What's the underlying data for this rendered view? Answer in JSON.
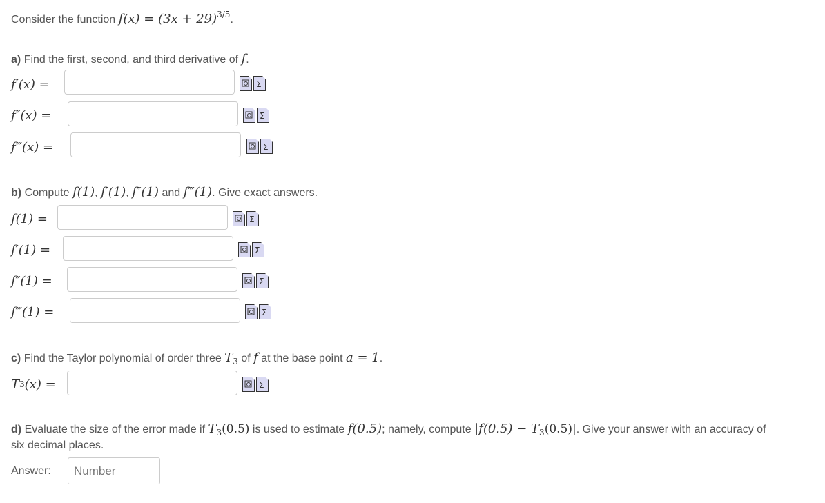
{
  "intro": {
    "prefix": "Consider the function",
    "func": "f(x) = (3x + 29)",
    "exponent": "3/5",
    "suffix": "."
  },
  "part_a": {
    "tag": "a)",
    "text": "Find the first, second, and third derivative of",
    "var": "f",
    "end": ".",
    "rows": [
      {
        "label": "f′(x) ="
      },
      {
        "label": "f″(x) ="
      },
      {
        "label": "f‴(x) ="
      }
    ]
  },
  "part_b": {
    "tag": "b)",
    "text_start": "Compute",
    "items": [
      "f(1)",
      "f′(1)",
      "f″(1)"
    ],
    "and_word": "and",
    "last": "f‴(1)",
    "text_end": ". Give exact answers.",
    "rows": [
      {
        "label": "f(1) ="
      },
      {
        "label": "f′(1) ="
      },
      {
        "label": "f″(1) ="
      },
      {
        "label": "f‴(1) ="
      }
    ]
  },
  "part_c": {
    "tag": "c)",
    "text1": "Find the Taylor polynomial of order three",
    "T": "T",
    "sub": "3",
    "text2": "of",
    "var": "f",
    "text3": "at the base point",
    "point": "a = 1",
    "end": ".",
    "row_label_T": "T",
    "row_label_sub": "3",
    "row_label_rest": "(x) ="
  },
  "part_d": {
    "tag": "d)",
    "text1": "Evaluate the size of the error made if",
    "expr1_T": "T",
    "expr1_sub": "3",
    "expr1_rest": "(0.5)",
    "text2": "is used to estimate",
    "expr2": "f(0.5)",
    "text3": "; namely, compute",
    "expr3_a": "|f(0.5) − T",
    "expr3_sub": "3",
    "expr3_b": "(0.5)|",
    "text4": ". Give your answer with an accuracy of",
    "line2": "six decimal places.",
    "answer_label": "Answer:",
    "answer_placeholder": "Number",
    "answer_value": ""
  },
  "icons": {
    "preview": "preview-icon",
    "equation": "equation-editor-icon",
    "color_fill": "#d9d9f2",
    "color_stroke": "#333333"
  }
}
